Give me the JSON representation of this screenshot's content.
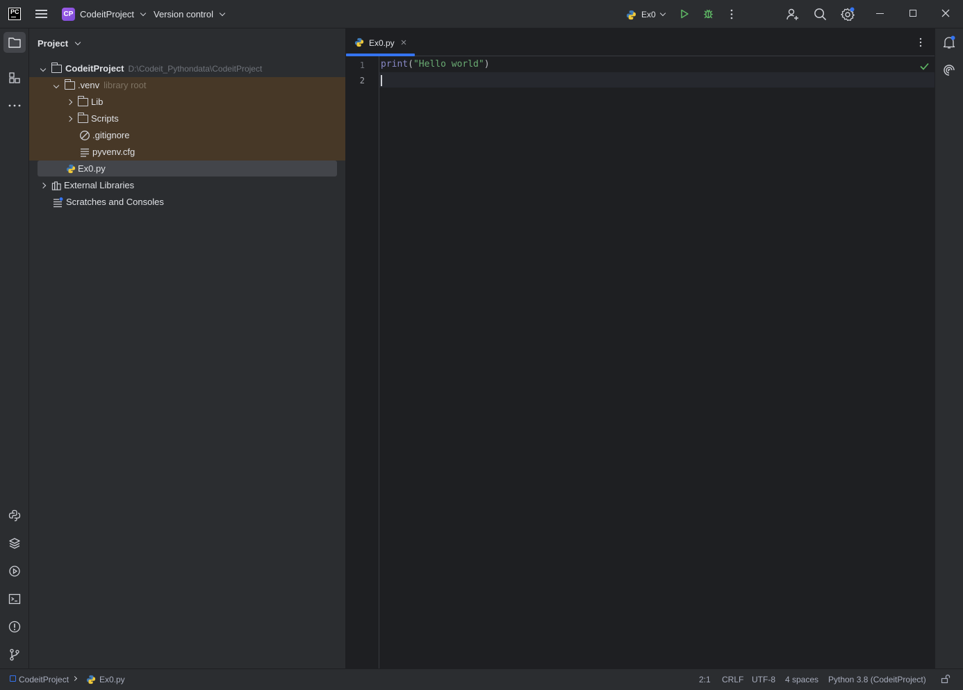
{
  "titlebar": {
    "logo_text": "PC",
    "project_badge": "CP",
    "project_name": "CodeitProject",
    "vcs_label": "Version control",
    "run_config": "Ex0"
  },
  "project_panel": {
    "title": "Project",
    "tree": {
      "root": {
        "label": "CodeitProject",
        "path": "D:\\Codeit_Pythondata\\CodeitProject"
      },
      "venv": {
        "label": ".venv",
        "hint": "library root"
      },
      "lib": "Lib",
      "scripts": "Scripts",
      "gitignore": ".gitignore",
      "pyvenv": "pyvenv.cfg",
      "ex0": "Ex0.py",
      "external": "External Libraries",
      "scratches": "Scratches and Consoles"
    }
  },
  "editor": {
    "tab_label": "Ex0.py",
    "lines": [
      "1",
      "2"
    ],
    "code": {
      "func": "print",
      "open": "(",
      "string": "\"Hello world\"",
      "close": ")"
    }
  },
  "statusbar": {
    "breadcrumb_project": "CodeitProject",
    "breadcrumb_file": "Ex0.py",
    "position": "2:1",
    "line_sep": "CRLF",
    "encoding": "UTF-8",
    "indent": "4 spaces",
    "interpreter": "Python 3.8 (CodeitProject)"
  },
  "colors": {
    "accent": "#3574f0",
    "venv_highlight": "#4b3a2a",
    "selection": "#43454a",
    "string": "#6aab73",
    "run_green": "#5fb865"
  }
}
